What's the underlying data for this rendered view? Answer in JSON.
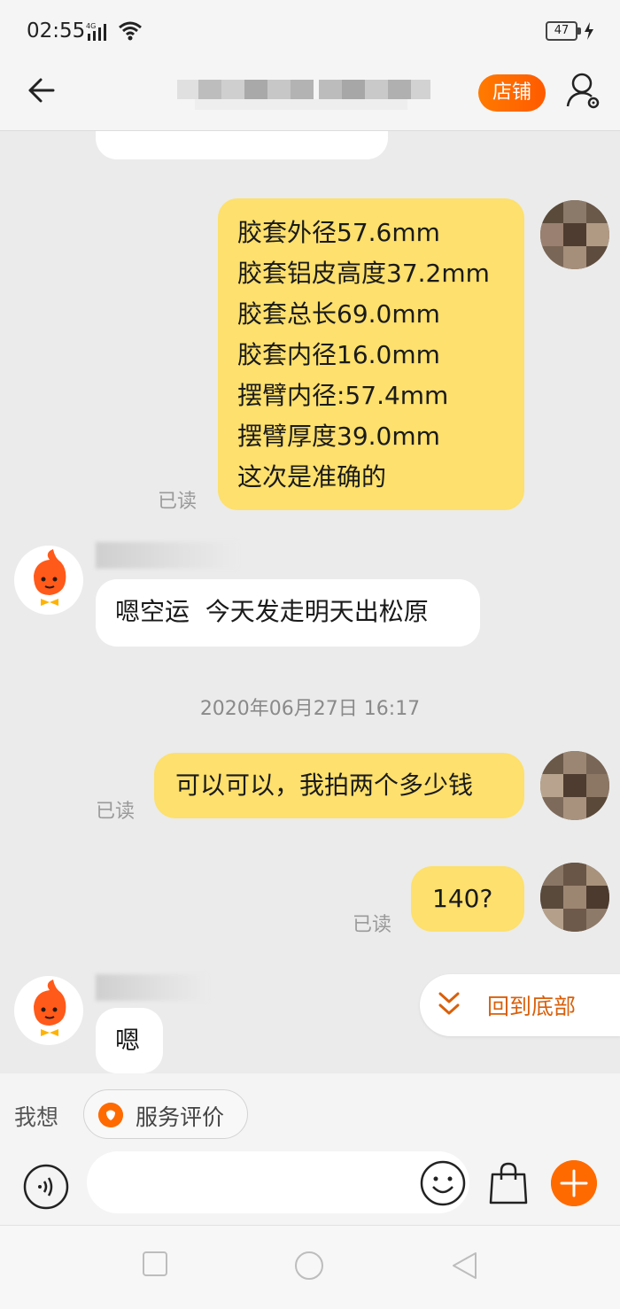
{
  "status_bar": {
    "time": "02:55",
    "network": "4G",
    "battery": "47"
  },
  "header": {
    "shop_button": "店铺"
  },
  "colors": {
    "accent": "#ff6a00",
    "outgoing_bubble": "#fde06d",
    "incoming_bubble": "#ffffff",
    "background": "#ebebeb"
  },
  "messages": {
    "m1": {
      "lines": [
        "胶套外径57.6mm",
        "胶套铝皮高度37.2mm",
        "胶套总长69.0mm",
        "胶套内径16.0mm",
        "摆臂内径:57.4mm",
        "摆臂厚度39.0mm",
        "这次是准确的"
      ],
      "read": "已读"
    },
    "m2": {
      "text": "嗯空运  今天发走明天出松原"
    },
    "timestamp": "2020年06月27日 16:17",
    "m3": {
      "text": "可以可以，我拍两个多少钱",
      "read": "已读"
    },
    "m4": {
      "text": "140?",
      "read": "已读"
    },
    "m5": {
      "text": "嗯"
    }
  },
  "back_to_bottom": "回到底部",
  "quick": {
    "label": "我想",
    "chip": "服务评价"
  },
  "icons": [
    "back-arrow-icon",
    "signal-icon",
    "wifi-icon",
    "battery-icon",
    "charging-icon",
    "profile-settings-icon",
    "chevron-double-down-icon",
    "voice-icon",
    "emoji-icon",
    "shopping-bag-icon",
    "plus-icon",
    "square-nav-icon",
    "circle-nav-icon",
    "triangle-nav-icon"
  ]
}
